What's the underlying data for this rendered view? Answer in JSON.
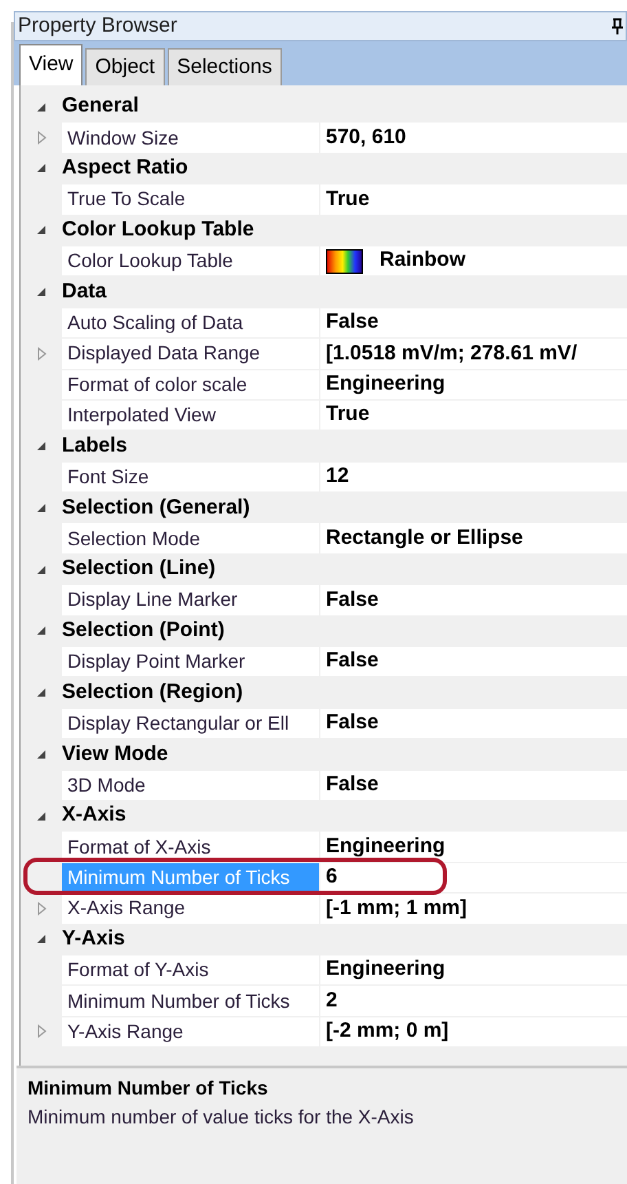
{
  "window": {
    "title": "Property Browser"
  },
  "tabs": [
    {
      "label": "View",
      "selected": true
    },
    {
      "label": "Object",
      "selected": false
    },
    {
      "label": "Selections",
      "selected": false
    }
  ],
  "groups": [
    {
      "name": "General",
      "expanded": true,
      "items": [
        {
          "label": "Window Size",
          "value": "570, 610",
          "expandable": true,
          "selected": false
        }
      ]
    },
    {
      "name": "Aspect Ratio",
      "expanded": true,
      "items": [
        {
          "label": "True To Scale",
          "value": "True",
          "expandable": false,
          "selected": false
        }
      ]
    },
    {
      "name": "Color Lookup Table",
      "expanded": true,
      "items": [
        {
          "label": "Color Lookup Table",
          "value": "Rainbow",
          "kind": "colormap",
          "expandable": false,
          "selected": false
        }
      ]
    },
    {
      "name": "Data",
      "expanded": true,
      "items": [
        {
          "label": "Auto Scaling of Data",
          "value": "False",
          "expandable": false,
          "selected": false
        },
        {
          "label": "Displayed Data Range",
          "value": "[1.0518 mV/m; 278.61 mV/",
          "expandable": true,
          "selected": false
        },
        {
          "label": "Format of color scale",
          "value": "Engineering",
          "expandable": false,
          "selected": false
        },
        {
          "label": "Interpolated View",
          "value": "True",
          "expandable": false,
          "selected": false
        }
      ]
    },
    {
      "name": "Labels",
      "expanded": true,
      "items": [
        {
          "label": "Font Size",
          "value": "12",
          "expandable": false,
          "selected": false
        }
      ]
    },
    {
      "name": "Selection (General)",
      "expanded": true,
      "items": [
        {
          "label": "Selection Mode",
          "value": "Rectangle or Ellipse",
          "expandable": false,
          "selected": false
        }
      ]
    },
    {
      "name": "Selection (Line)",
      "expanded": true,
      "items": [
        {
          "label": "Display Line Marker",
          "value": "False",
          "expandable": false,
          "selected": false
        }
      ]
    },
    {
      "name": "Selection (Point)",
      "expanded": true,
      "items": [
        {
          "label": "Display Point Marker",
          "value": "False",
          "expandable": false,
          "selected": false
        }
      ]
    },
    {
      "name": "Selection (Region)",
      "expanded": true,
      "items": [
        {
          "label": "Display Rectangular or Ell",
          "value": "False",
          "expandable": false,
          "selected": false
        }
      ]
    },
    {
      "name": "View Mode",
      "expanded": true,
      "items": [
        {
          "label": "3D Mode",
          "value": "False",
          "expandable": false,
          "selected": false
        }
      ]
    },
    {
      "name": "X-Axis",
      "expanded": true,
      "items": [
        {
          "label": "Format of X-Axis",
          "value": "Engineering",
          "expandable": false,
          "selected": false
        },
        {
          "label": "Minimum Number of Ticks",
          "value": "6",
          "expandable": false,
          "selected": true
        },
        {
          "label": "X-Axis Range",
          "value": "[-1 mm; 1 mm]",
          "expandable": true,
          "selected": false
        }
      ]
    },
    {
      "name": "Y-Axis",
      "expanded": true,
      "items": [
        {
          "label": "Format of Y-Axis",
          "value": "Engineering",
          "expandable": false,
          "selected": false
        },
        {
          "label": "Minimum Number of Ticks",
          "value": "2",
          "expandable": false,
          "selected": false
        },
        {
          "label": "Y-Axis Range",
          "value": "[-2 mm; 0 m]",
          "expandable": true,
          "selected": false
        }
      ]
    }
  ],
  "description": {
    "title": "Minimum Number of Ticks",
    "text": "Minimum number of value ticks for the X-Axis"
  }
}
